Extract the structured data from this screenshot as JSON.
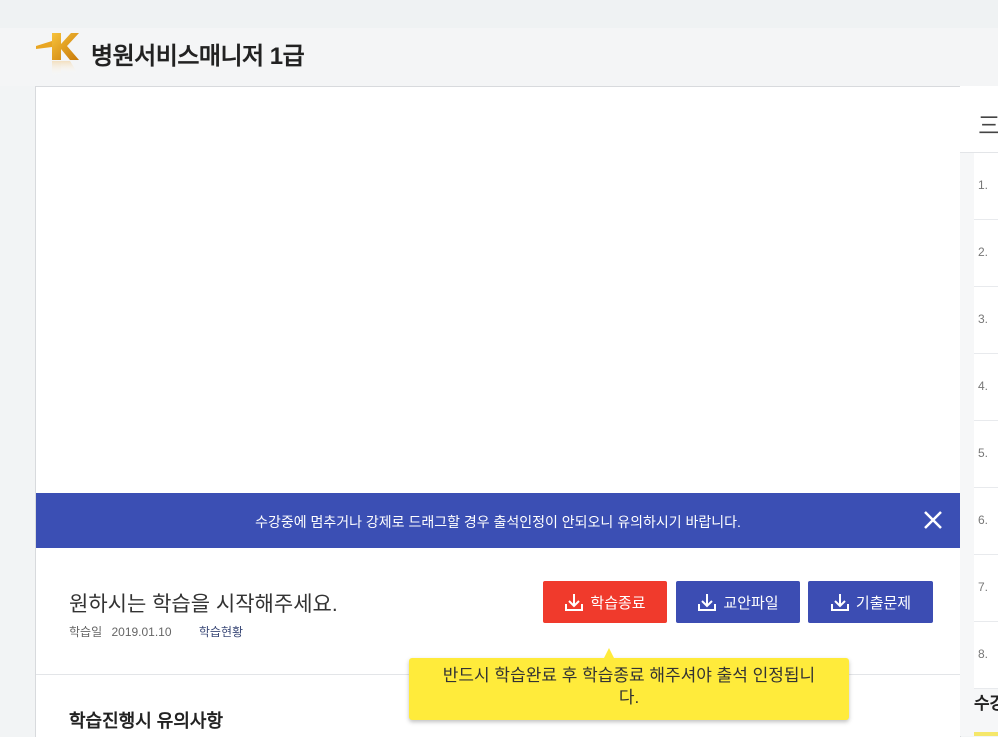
{
  "header": {
    "course_title": "병원서비스매니저 1급"
  },
  "player": {
    "notice": "수강중에 멈추거나 강제로 드래그할 경우 출석인정이 안되오니 유의하시기 바랍니다.",
    "status_text": "원하시는 학습을 시작해주세요.",
    "study_date_label": "학습일",
    "study_date": "2019.01.10",
    "progress_link": "학습현황"
  },
  "buttons": {
    "end_study": "학습종료",
    "lecture_file": "교안파일",
    "past_exams": "기출문제"
  },
  "tooltip": {
    "line1": "반드시 학습완료 후 학습종료 해주셔야 출석 인정됩니",
    "line2": "다."
  },
  "notes": {
    "title": "학습진행시 유의사항"
  },
  "sidebar": {
    "head": "三이",
    "lessons": [
      "1.",
      "2.",
      "3.",
      "4.",
      "5.",
      "6.",
      "7.",
      "8."
    ],
    "bottom_label": "수강"
  },
  "colors": {
    "notice_bar": "#3b4fb4",
    "end_button": "#f03a2c",
    "primary_button": "#3c4db3",
    "tooltip": "#ffeb3b"
  },
  "icons": [
    "k-logo",
    "close-icon",
    "download-icon"
  ]
}
